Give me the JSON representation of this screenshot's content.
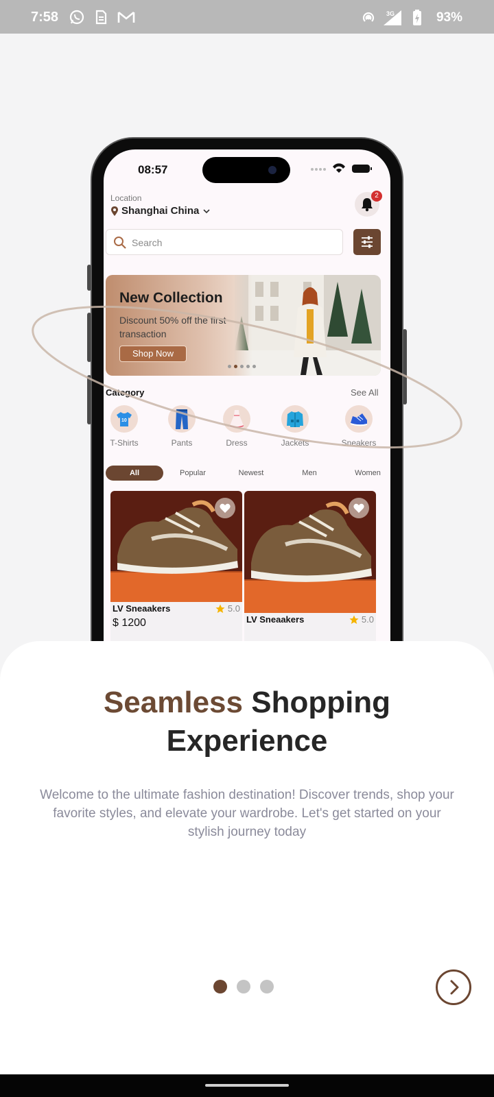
{
  "status_bar": {
    "time": "7:58",
    "battery": "93%",
    "network": "3G",
    "icons": [
      "whatsapp-icon",
      "sim-icon",
      "gmail-icon",
      "hotspot-icon",
      "signal-icon",
      "battery-icon"
    ]
  },
  "mockup": {
    "time": "08:57",
    "location_label": "Location",
    "location_value": "Shanghai China",
    "notification_count": "2",
    "search_placeholder": "Search",
    "banner": {
      "title": "New Collection",
      "subtitle": "Discount 50% off the first transaction",
      "button": "Shop Now",
      "active_dot": 1,
      "dot_count": 5
    },
    "category_title": "Category",
    "see_all": "See All",
    "categories": [
      {
        "label": "T-Shirts",
        "icon": "tshirt-icon"
      },
      {
        "label": "Pants",
        "icon": "pants-icon"
      },
      {
        "label": "Dress",
        "icon": "dress-icon"
      },
      {
        "label": "Jackets",
        "icon": "jacket-icon"
      },
      {
        "label": "Sneakers",
        "icon": "sneaker-icon"
      }
    ],
    "filters": [
      "All",
      "Popular",
      "Newest",
      "Men",
      "Women"
    ],
    "active_filter": "All",
    "products": [
      {
        "name": "LV Sneaakers",
        "rating": "5.0",
        "price": "$ 1200"
      },
      {
        "name": "LV Sneaakers",
        "rating": "5.0"
      }
    ]
  },
  "onboarding": {
    "headline_accent": "Seamless",
    "headline_rest": " Shopping",
    "headline_line2": "Experience",
    "description": "Welcome to the ultimate fashion destination! Discover trends, shop your favorite styles, and elevate your wardrobe. Let's get started on your stylish journey today",
    "page_count": 3,
    "active_page": 1
  },
  "colors": {
    "brand_brown": "#6b4631",
    "accent_text": "#6c4a34",
    "badge_red": "#d32f2f",
    "star_yellow": "#f5b400"
  }
}
